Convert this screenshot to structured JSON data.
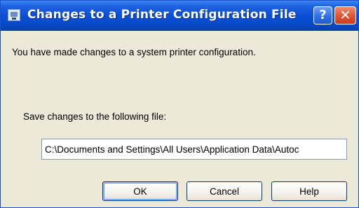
{
  "window": {
    "title": "Changes to a Printer Configuration File",
    "help_glyph": "?",
    "close_glyph": "✕"
  },
  "body": {
    "message": "You have made changes to a system printer configuration.",
    "save_label": "Save changes to the following file:",
    "file_path": "C:\\Documents and Settings\\All Users\\Application Data\\Autoc"
  },
  "buttons": {
    "ok": "OK",
    "cancel": "Cancel",
    "help": "Help"
  },
  "icons": {
    "app": "printer-config-icon",
    "help": "help-icon",
    "close": "close-icon"
  },
  "colors": {
    "titlebar": "#0a4fd8",
    "close_button": "#e2532f",
    "dialog_background": "#ece9d8"
  }
}
